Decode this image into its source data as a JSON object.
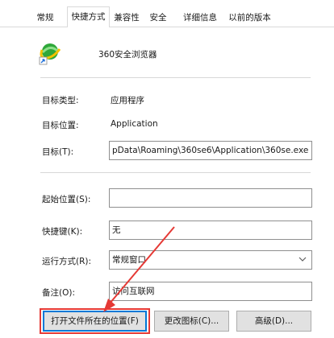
{
  "tabs": [
    "常规",
    "快捷方式",
    "兼容性",
    "安全",
    "详细信息",
    "以前的版本"
  ],
  "active_tab": "快捷方式",
  "app": {
    "name": "360安全浏览器",
    "icon": "360-browser-icon"
  },
  "fields": {
    "target_type": {
      "label": "目标类型:",
      "value": "应用程序"
    },
    "target_location": {
      "label": "目标位置:",
      "value": "Application"
    },
    "target": {
      "label": "目标(T):",
      "value": "pData\\Roaming\\360se6\\Application\\360se.exe"
    },
    "start_in": {
      "label": "起始位置(S):",
      "value": ""
    },
    "hotkey": {
      "label": "快捷键(K):",
      "value": "无"
    },
    "run": {
      "label": "运行方式(R):",
      "value": "常规窗口"
    },
    "comment": {
      "label": "备注(O):",
      "value": "访问互联网"
    }
  },
  "buttons": {
    "open_location": "打开文件所在的位置(F)",
    "change_icon": "更改图标(C)...",
    "advanced": "高级(D)..."
  },
  "colors": {
    "annotation": "#e53935",
    "focus": "#0078d7"
  }
}
